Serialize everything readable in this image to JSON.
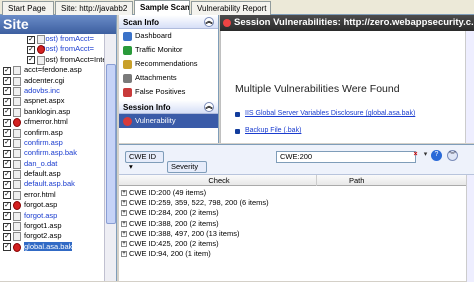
{
  "tabs": [
    {
      "label": "Start Page",
      "active": false
    },
    {
      "label": "Site: http://javabb2",
      "active": false
    },
    {
      "label": "Sample Scan",
      "active": true
    },
    {
      "label": "Vulnerability Report",
      "active": false
    }
  ],
  "site_panel": {
    "title": "Site",
    "items": [
      {
        "label": "(Post) fromAcct=",
        "color": "blue",
        "icon": "page",
        "nested": true
      },
      {
        "label": "(Post) fromAcct=",
        "color": "blue",
        "icon": "alert",
        "nested": true
      },
      {
        "label": "(Post) fromAcct=Inter",
        "color": "black",
        "icon": "page",
        "nested": true
      },
      {
        "label": "acct=ferdone.asp",
        "color": "black",
        "icon": "page",
        "nested": false
      },
      {
        "label": "adcenter.cgi",
        "color": "black",
        "icon": "page",
        "nested": false
      },
      {
        "label": "adovbs.inc",
        "color": "blue",
        "icon": "page",
        "nested": false
      },
      {
        "label": "aspnet.aspx",
        "color": "black",
        "icon": "page",
        "nested": false
      },
      {
        "label": "banklogin.asp",
        "color": "black",
        "icon": "page",
        "nested": false
      },
      {
        "label": "cfmerror.html",
        "color": "black",
        "icon": "alert",
        "nested": false
      },
      {
        "label": "confirm.asp",
        "color": "black",
        "icon": "page",
        "nested": false
      },
      {
        "label": "confirm.asp",
        "color": "blue",
        "icon": "page",
        "nested": false
      },
      {
        "label": "confirm.asp.bak",
        "color": "blue",
        "icon": "page",
        "nested": false
      },
      {
        "label": "dan_o.dat",
        "color": "blue",
        "icon": "page",
        "nested": false
      },
      {
        "label": "default.asp",
        "color": "black",
        "icon": "page",
        "nested": false
      },
      {
        "label": "default.asp.bak",
        "color": "blue",
        "icon": "page",
        "nested": false
      },
      {
        "label": "error.html",
        "color": "black",
        "icon": "page",
        "nested": false
      },
      {
        "label": "forgot.asp",
        "color": "black",
        "icon": "alert",
        "nested": false
      },
      {
        "label": "forgot.asp",
        "color": "blue",
        "icon": "page",
        "nested": false
      },
      {
        "label": "forgot1.asp",
        "color": "black",
        "icon": "page",
        "nested": false
      },
      {
        "label": "forgot2.asp",
        "color": "black",
        "icon": "page",
        "nested": false
      },
      {
        "label": "global.asa.bak",
        "color": "black",
        "icon": "alert",
        "nested": false,
        "selected": true
      }
    ]
  },
  "scan_info": {
    "title": "Scan Info",
    "items": [
      {
        "label": "Dashboard",
        "icon": "dashboard-icon",
        "color": "#3b72c8"
      },
      {
        "label": "Traffic Monitor",
        "icon": "traffic-monitor-icon",
        "color": "#2a9a3a"
      },
      {
        "label": "Recommendations",
        "icon": "recommendations-icon",
        "color": "#c8a02a"
      },
      {
        "label": "Attachments",
        "icon": "attachments-icon",
        "color": "#7a7a7a"
      },
      {
        "label": "False Positives",
        "icon": "false-positives-icon",
        "color": "#c83a3a"
      }
    ]
  },
  "session_info": {
    "title": "Session Info",
    "items": [
      {
        "label": "Vulnerability",
        "icon": "vulnerability-icon",
        "color": "#d83a3a",
        "active": true
      }
    ]
  },
  "session_vulns": {
    "header": "Session Vulnerabilities: http://zero.webappsecurity.c...",
    "heading": "Multiple Vulnerabilities Were Found",
    "links": [
      "IIS Global Server Variables Disclosure (global.asa.bak)",
      "Backup File (.bak)"
    ]
  },
  "filter_bar": {
    "group1": "CWE ID",
    "group2": "Severity",
    "filter_value": "CWE:200"
  },
  "grid": {
    "columns": [
      "Check",
      "Path"
    ],
    "rows": [
      "CWE ID:200 (49 items)",
      "CWE ID:259, 359, 522, 798, 200  (6 items)",
      "CWE ID:284, 200  (2 items)",
      "CWE ID:388, 200  (2 items)",
      "CWE ID:388, 497, 200  (13 items)",
      "CWE ID:425, 200  (2 items)",
      "CWE ID:94, 200  (1 item)"
    ]
  }
}
